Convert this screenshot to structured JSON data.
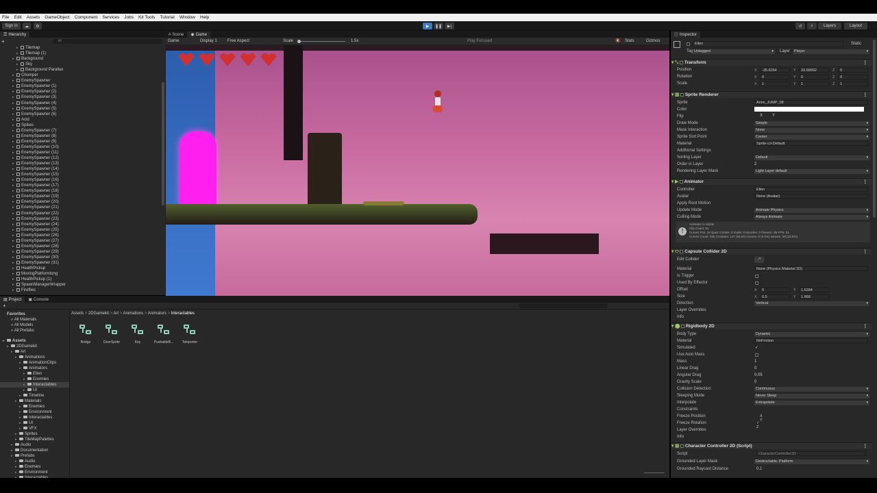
{
  "menu": [
    "File",
    "Edit",
    "Assets",
    "GameObject",
    "Component",
    "Services",
    "Jobs",
    "Kit Tools",
    "Tutorial",
    "Window",
    "Help"
  ],
  "toolbar": {
    "sign_in": "Sign in",
    "layers": "Layers",
    "layout": "Layout"
  },
  "hierarchy": {
    "tab": "Hierarchy",
    "search_placeholder": "All",
    "items": [
      {
        "label": "Tilemap",
        "indent": 3
      },
      {
        "label": "Tilemap (1)",
        "indent": 3
      },
      {
        "label": "Background",
        "indent": 2
      },
      {
        "label": "Sky",
        "indent": 3
      },
      {
        "label": "Background Parallax",
        "indent": 3
      },
      {
        "label": "Chomper",
        "indent": 2
      },
      {
        "label": "EnemySpawner",
        "indent": 2
      },
      {
        "label": "EnemySpawner (1)",
        "indent": 2
      },
      {
        "label": "EnemySpawner (2)",
        "indent": 2
      },
      {
        "label": "EnemySpawner (3)",
        "indent": 2
      },
      {
        "label": "EnemySpawner (4)",
        "indent": 2
      },
      {
        "label": "EnemySpawner (5)",
        "indent": 2
      },
      {
        "label": "EnemySpawner (6)",
        "indent": 2
      },
      {
        "label": "Acid",
        "indent": 2
      },
      {
        "label": "Spikes",
        "indent": 2
      },
      {
        "label": "EnemySpawner (7)",
        "indent": 2
      },
      {
        "label": "EnemySpawner (8)",
        "indent": 2
      },
      {
        "label": "EnemySpawner (9)",
        "indent": 2
      },
      {
        "label": "EnemySpawner (10)",
        "indent": 2
      },
      {
        "label": "EnemySpawner (11)",
        "indent": 2
      },
      {
        "label": "EnemySpawner (12)",
        "indent": 2
      },
      {
        "label": "EnemySpawner (13)",
        "indent": 2
      },
      {
        "label": "EnemySpawner (14)",
        "indent": 2
      },
      {
        "label": "EnemySpawner (15)",
        "indent": 2
      },
      {
        "label": "EnemySpawner (16)",
        "indent": 2
      },
      {
        "label": "EnemySpawner (17)",
        "indent": 2
      },
      {
        "label": "EnemySpawner (18)",
        "indent": 2
      },
      {
        "label": "EnemySpawner (19)",
        "indent": 2
      },
      {
        "label": "EnemySpawner (20)",
        "indent": 2
      },
      {
        "label": "EnemySpawner (21)",
        "indent": 2
      },
      {
        "label": "EnemySpawner (22)",
        "indent": 2
      },
      {
        "label": "EnemySpawner (23)",
        "indent": 2
      },
      {
        "label": "EnemySpawner (24)",
        "indent": 2
      },
      {
        "label": "EnemySpawner (25)",
        "indent": 2
      },
      {
        "label": "EnemySpawner (26)",
        "indent": 2
      },
      {
        "label": "EnemySpawner (27)",
        "indent": 2
      },
      {
        "label": "EnemySpawner (28)",
        "indent": 2
      },
      {
        "label": "EnemySpawner (29)",
        "indent": 2
      },
      {
        "label": "EnemySpawner (30)",
        "indent": 2
      },
      {
        "label": "EnemySpawner (31)",
        "indent": 2
      },
      {
        "label": "HealthPickup",
        "indent": 2
      },
      {
        "label": "MovingPlatformlong",
        "indent": 2
      },
      {
        "label": "HealthPickup (1)",
        "indent": 2
      },
      {
        "label": "SpawnManagerWrapper",
        "indent": 2
      },
      {
        "label": "Fireflies",
        "indent": 2
      }
    ]
  },
  "scene_tabs": {
    "scene": "Scene",
    "game": "Game"
  },
  "game_bar": {
    "mode": "Game",
    "display": "Display 1",
    "aspect": "Free Aspect",
    "scale_label": "Scale",
    "scale_value": "1.5x",
    "play_focused": "Play Focused",
    "stats": "Stats",
    "gizmos": "Gizmos"
  },
  "project": {
    "tab_project": "Project",
    "tab_console": "Console",
    "breadcrumb": [
      "Assets",
      "2DGamekit",
      "Art",
      "Animations",
      "Animators",
      "Interactables"
    ],
    "favorites": "Favorites",
    "fav_items": [
      "All Materials",
      "All Models",
      "All Prefabs"
    ],
    "tree": [
      {
        "label": "Assets",
        "indent": 0,
        "bold": true
      },
      {
        "label": "2DGamekit",
        "indent": 1
      },
      {
        "label": "Art",
        "indent": 2
      },
      {
        "label": "Animations",
        "indent": 3
      },
      {
        "label": "AnimationClips",
        "indent": 4
      },
      {
        "label": "Animators",
        "indent": 4
      },
      {
        "label": "Ellen",
        "indent": 5
      },
      {
        "label": "Enemies",
        "indent": 5
      },
      {
        "label": "Interactables",
        "indent": 5,
        "selected": true
      },
      {
        "label": "UI",
        "indent": 5
      },
      {
        "label": "Timeline",
        "indent": 4
      },
      {
        "label": "Materials",
        "indent": 3
      },
      {
        "label": "Enemies",
        "indent": 4
      },
      {
        "label": "Environment",
        "indent": 4
      },
      {
        "label": "Interactables",
        "indent": 4
      },
      {
        "label": "UI",
        "indent": 4
      },
      {
        "label": "VFX",
        "indent": 4
      },
      {
        "label": "Sprites",
        "indent": 3
      },
      {
        "label": "TileMapPalettes",
        "indent": 3
      },
      {
        "label": "Audio",
        "indent": 2
      },
      {
        "label": "Documentation",
        "indent": 2
      },
      {
        "label": "Prefabs",
        "indent": 2
      },
      {
        "label": "Audio",
        "indent": 3
      },
      {
        "label": "Enemies",
        "indent": 3
      },
      {
        "label": "Environment",
        "indent": 3
      },
      {
        "label": "Interactables",
        "indent": 3
      }
    ],
    "assets": [
      "Bridge",
      "DoorSprite",
      "Key",
      "PushableB...",
      "Teleporter"
    ]
  },
  "inspector": {
    "tab": "Inspector",
    "name": "Ellen",
    "static": "Static",
    "tag_label": "Tag",
    "tag": "Untagged",
    "layer_label": "Layer",
    "layer": "Player",
    "transform": {
      "title": "Transform",
      "position": [
        "-35.6264",
        "33.58992",
        "0"
      ],
      "rotation": [
        "0",
        "0",
        "0"
      ],
      "scale": [
        "1",
        "1",
        "1"
      ],
      "labels": [
        "Position",
        "Rotation",
        "Scale"
      ]
    },
    "sprite_renderer": {
      "title": "Sprite Renderer",
      "sprite": "Anim_JUMP_08",
      "flip": "X",
      "flip_y": "Y",
      "draw_mode": "Simple",
      "mask": "None",
      "sort_point": "Center",
      "material": "Sprite-Lit-Default",
      "additional": "Additional Settings",
      "sorting_layer": "Default",
      "order": "2",
      "rendering_mask": "Light Layer default",
      "labels": [
        "Sprite",
        "Color",
        "Flip",
        "Draw Mode",
        "Mask Interaction",
        "Sprite Sort Point",
        "Material",
        "Sorting Layer",
        "Order in Layer",
        "Rendering Layer Mask"
      ]
    },
    "animator": {
      "title": "Animator",
      "controller": "Ellen",
      "avatar": "None (Avatar)",
      "update_mode": "Animate Physics",
      "culling": "Always Animate",
      "labels": [
        "Controller",
        "Avatar",
        "Apply Root Motion",
        "Update Mode",
        "Culling Mode"
      ],
      "info": [
        "Animator is visible",
        "Clip Count: 51",
        "Curves Pos: 19 Quat: 0 Euler: 0 Scale: 0 Muscles: 0 Generic: 98 PPtr: 51",
        "Curves Count: 206 Constant: 137 (66.5%) Dense: 0 (0.0%) Stream: 69 (33.5%)"
      ]
    },
    "capsule": {
      "title": "Capsule Collider 2D",
      "material": "None (Physics Material 2D)",
      "offset": [
        "0",
        "1.6284"
      ],
      "size": [
        "0.5",
        "1.968"
      ],
      "direction": "Vertical",
      "labels": [
        "Edit Collider",
        "Material",
        "Is Trigger",
        "Used By Effector",
        "Offset",
        "Size",
        "Direction",
        "Layer Overrides",
        "Info"
      ]
    },
    "rigidbody": {
      "title": "Rigidbody 2D",
      "body_type": "Dynamic",
      "material": "NoFriction",
      "mass": "1",
      "linear_drag": "0",
      "angular_drag": "0.05",
      "gravity": "0",
      "collision": "Continuous",
      "sleeping": "Never Sleep",
      "interpolate": "Extrapolate",
      "labels": [
        "Body Type",
        "Material",
        "Simulated",
        "Use Auto Mass",
        "Mass",
        "Linear Drag",
        "Angular Drag",
        "Gravity Scale",
        "Collision Detection",
        "Sleeping Mode",
        "Interpolate",
        "Constraints",
        "Freeze Position",
        "Freeze Rotation",
        "Layer Overrides",
        "Info"
      ]
    },
    "controller": {
      "title": "Character Controller 2D (Script)",
      "script": "CharacterController2D",
      "grounded_mask": "Destructable, Platform",
      "raycast": "0.1",
      "labels": [
        "Script",
        "Grounded Layer Mask",
        "Grounded Raycast Distance"
      ]
    }
  },
  "colors": {
    "accent": "#3a79bb",
    "panel": "#282828",
    "portal": "#ff20f0",
    "sky": "#c96aa0",
    "heart": "#d23030"
  },
  "hud": {
    "hearts": 5
  }
}
